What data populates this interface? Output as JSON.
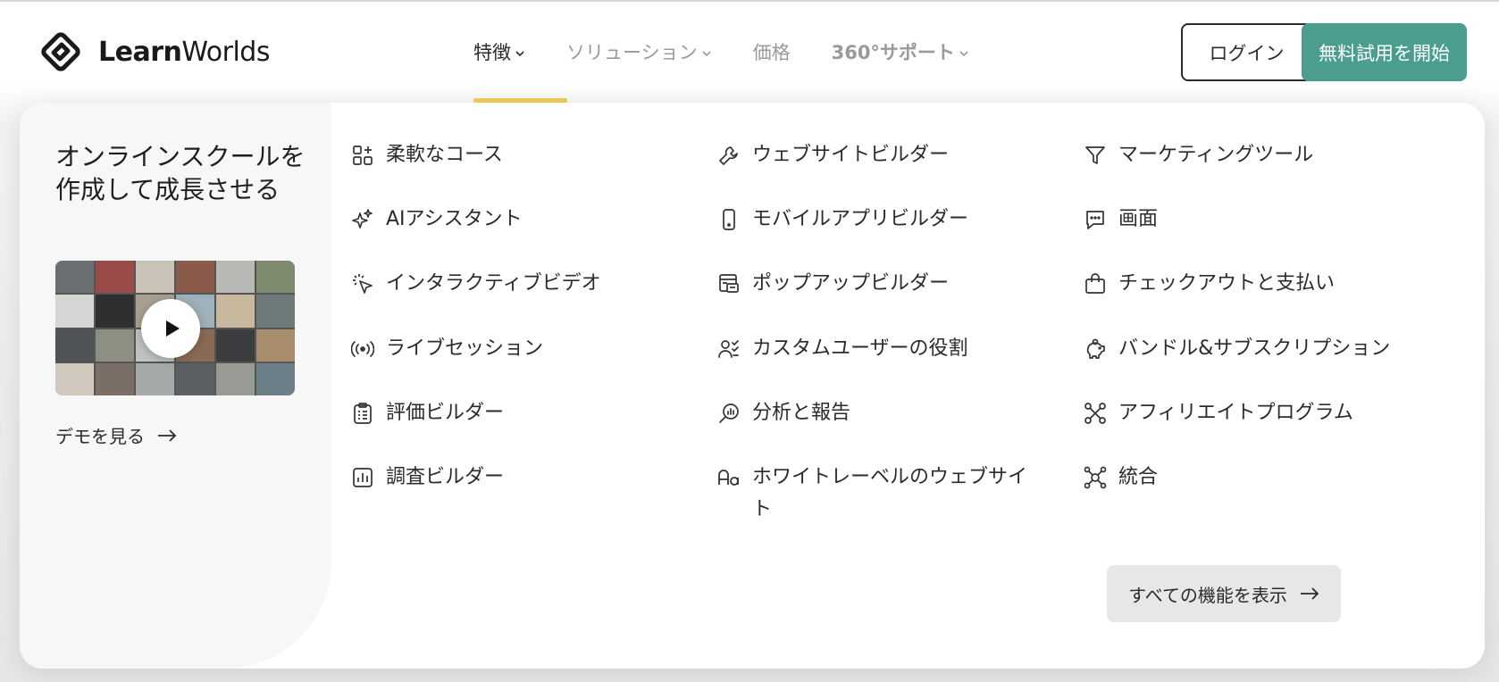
{
  "header": {
    "logo": {
      "bold": "Learn",
      "light": "Worlds"
    },
    "nav": [
      {
        "label": "特徴",
        "active": true,
        "has_dropdown": true
      },
      {
        "label": "ソリューション",
        "active": false,
        "has_dropdown": true
      },
      {
        "label": "価格",
        "active": false,
        "has_dropdown": false
      },
      {
        "label": "360°サポート",
        "active": false,
        "has_dropdown": true
      }
    ],
    "login_label": "ログイン",
    "trial_label": "無料試用を開始"
  },
  "promo": {
    "title": "オンラインスクールを作成して成長させる",
    "demo_link": "デモを見る"
  },
  "features": {
    "column1": [
      {
        "label": "柔軟なコース",
        "icon": "grid-plus-icon"
      },
      {
        "label": "AIアシスタント",
        "icon": "sparkles-icon"
      },
      {
        "label": "インタラクティブビデオ",
        "icon": "cursor-click-icon"
      },
      {
        "label": "ライブセッション",
        "icon": "broadcast-icon"
      },
      {
        "label": "評価ビルダー",
        "icon": "clipboard-icon"
      },
      {
        "label": "調査ビルダー",
        "icon": "bar-chart-icon"
      }
    ],
    "column2": [
      {
        "label": "ウェブサイトビルダー",
        "icon": "wrench-icon"
      },
      {
        "label": "モバイルアプリビルダー",
        "icon": "mobile-icon"
      },
      {
        "label": "ポップアップビルダー",
        "icon": "popup-icon"
      },
      {
        "label": "カスタムユーザーの役割",
        "icon": "user-roles-icon"
      },
      {
        "label": "分析と報告",
        "icon": "analytics-search-icon"
      },
      {
        "label": "ホワイトレーベルのウェブサイト",
        "icon": "font-icon"
      }
    ],
    "column3": [
      {
        "label": "マーケティングツール",
        "icon": "funnel-icon"
      },
      {
        "label": "画面",
        "icon": "chat-icon"
      },
      {
        "label": "チェックアウトと支払い",
        "icon": "shopping-bag-icon"
      },
      {
        "label": "バンドル&サブスクリプション",
        "icon": "piggy-bank-icon"
      },
      {
        "label": "アフィリエイトプログラム",
        "icon": "affiliate-network-icon"
      },
      {
        "label": "統合",
        "icon": "integrations-icon"
      }
    ],
    "all_features_label": "すべての機能を表示"
  },
  "colors": {
    "accent": "#4a9d8f",
    "nav_underline": "#f2cd5c",
    "text": "#2b2b2b",
    "muted": "#9a9a9a"
  }
}
